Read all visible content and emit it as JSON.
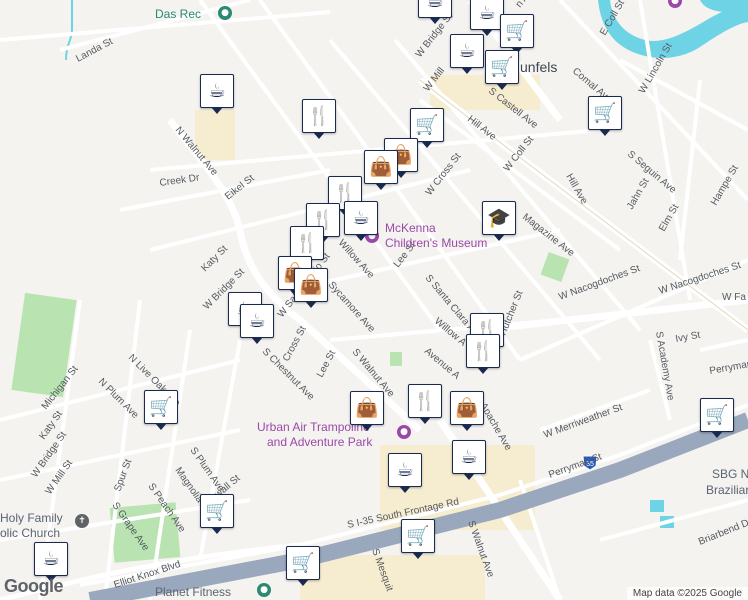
{
  "roads": {
    "das_rec": "Das Rec",
    "landa_st": "Landa St",
    "n_walnut_ave": "N Walnut Ave",
    "creek_dr": "Creek Dr",
    "eikel_st": "Eikel St",
    "katy_st_upper": "Katy St",
    "w_bridge_st_mid": "W Bridge St",
    "w_san_antonio_st": "W San Antonio St",
    "willow_ave": "Willow Ave",
    "lee_st_upper": "Lee St",
    "s_santa_clara_ave": "S Santa Clara Ave",
    "w_cross_st": "W Cross St",
    "magazine_ave": "Magazine Ave",
    "hill_ave": "Hill Ave",
    "s_castell_ave": "S Castell Ave",
    "w_coll_st": "W Coll St",
    "hill_ave_2": "Hill Ave",
    "comal_ave": "Comal Ave",
    "e_coll_st": "E Coll St",
    "w_lincoln_st": "W Lincoln St",
    "s_seguin_ave": "S Seguin Ave",
    "jahn_st": "Jahn St",
    "elm_st": "Elm St",
    "hampe_st": "Hampe St",
    "w_nacogdoches_st": "W Nacogdoches St",
    "w_nacogdoches_st_2": "W Nacogdoches St",
    "w_faust": "W Fa",
    "ivy_st": "Ivy St",
    "s_academy_ave": "S Academy Ave",
    "perryman": "Perryman",
    "w_merriweather_st": "W Merriweather St",
    "perryman_st": "Perryman St",
    "s_i35_frontage": "S I-35 South Frontage Rd",
    "i35_shield": "35",
    "sycamore_ave": "Sycamore Ave",
    "s_walnut_ave": "S Walnut Ave",
    "avenue_a": "Avenue A",
    "willow_ave_2": "Willow A",
    "apache_ave": "Apache Ave",
    "hutcher_st": "Hutcher St",
    "cross_st": "Cross St",
    "lee_st_lower": "Lee St",
    "s_chestnut_ave": "S Chestnut Ave",
    "n_live_oak_ave": "N Live Oak Ave",
    "michigan_st": "Michigan St",
    "n_plum_ave": "N Plum Ave",
    "katy_st_lower": "Katy St",
    "w_bridge_st_lower": "W Bridge St",
    "w_mill_st_lower": "W Mill St",
    "spur_st": "Spur St",
    "s_plum_ave": "S Plum Ave",
    "magnolia_ave": "Magnolia Ave",
    "hall_st": "wall St",
    "s_peach_ave": "S Peach Ave",
    "s_grape_ave": "S Grape Ave",
    "elliot_knox_blvd": "Elliot Knox Blvd",
    "s_mesquite": "S Mesquit",
    "s_walnut_ave_lower": "S Walnut Ave",
    "briarbend_dr": "Briarbend Dr",
    "w_bridge_st_upper": "W Bridge St",
    "w_mill": "W Mill",
    "new_braunfels_partial": "unfels",
    "n_ave": "n Ave"
  },
  "places": {
    "mckenna_line1": "McKenna",
    "mckenna_line2": "Children's Museum",
    "urban_air_line1": "Urban Air Trampoline",
    "urban_air_line2": "and Adventure Park",
    "holy_family_line1": "Holy Family",
    "holy_family_line2": "olic Church",
    "planet_fitness": "Planet Fitness",
    "sbg_line1": "SBG N",
    "sbg_line2": "Brazilian Jiu"
  },
  "markers": [
    {
      "type": "cafe",
      "icon": "coffee-cup"
    },
    {
      "type": "restaurant",
      "icon": "fork-knife"
    },
    {
      "type": "shopping",
      "icon": "shopping-bag"
    },
    {
      "type": "grocery",
      "icon": "shopping-cart"
    },
    {
      "type": "school",
      "icon": "graduation-cap"
    }
  ],
  "icons": {
    "cafe": "☕",
    "restaurant": "🍴",
    "bag": "👜",
    "cart": "🛒",
    "school": "🎓",
    "cross": "✝"
  },
  "colors": {
    "marker_border": "#1a2a4f",
    "water": "#6fd3e6",
    "park": "#b9e3b0",
    "highway": "#9aa8bd",
    "poi_purple": "#9b49a8"
  },
  "footer": {
    "logo": "Google",
    "attribution": "Map data ©2025 Google"
  }
}
